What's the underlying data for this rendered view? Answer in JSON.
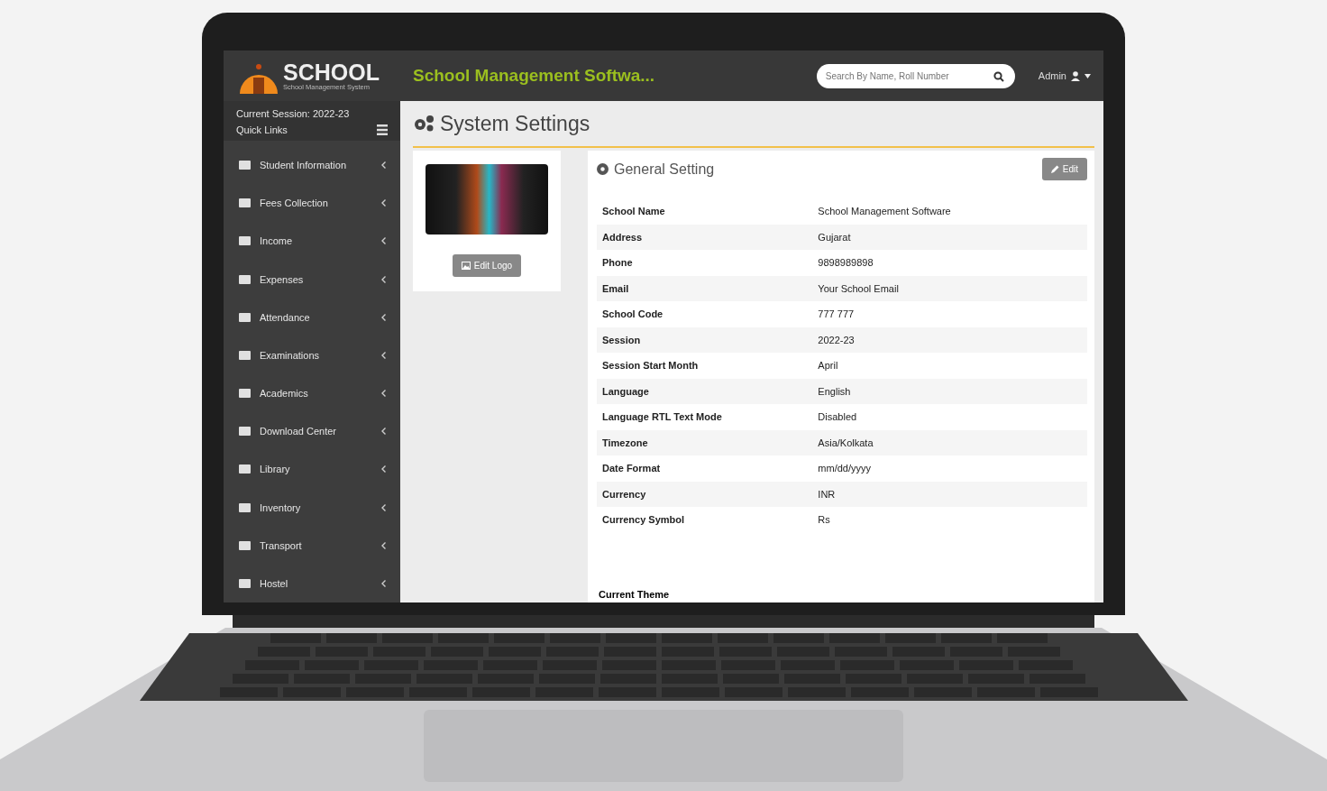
{
  "header": {
    "logo_text": "SCHOOL",
    "logo_subtitle": "School Management System",
    "title": "School Management Softwa...",
    "search": {
      "placeholder": "Search By Name, Roll Number"
    },
    "user": "Admin"
  },
  "sidebar": {
    "session": "Current Session: 2022-23",
    "quick_links": "Quick Links",
    "items": [
      {
        "label": "Student Information"
      },
      {
        "label": "Fees Collection"
      },
      {
        "label": "Income"
      },
      {
        "label": "Expenses"
      },
      {
        "label": "Attendance"
      },
      {
        "label": "Examinations"
      },
      {
        "label": "Academics"
      },
      {
        "label": "Download Center"
      },
      {
        "label": "Library"
      },
      {
        "label": "Inventory"
      },
      {
        "label": "Transport"
      },
      {
        "label": "Hostel"
      }
    ]
  },
  "page_title": "System Settings",
  "logo_card": {
    "edit_button": "Edit Logo"
  },
  "general_setting": {
    "title": "General Setting",
    "edit_button": "Edit",
    "rows": [
      {
        "label": "School Name",
        "value": "School Management Software"
      },
      {
        "label": "Address",
        "value": "Gujarat"
      },
      {
        "label": "Phone",
        "value": "9898989898"
      },
      {
        "label": "Email",
        "value": "Your School Email"
      },
      {
        "label": "School Code",
        "value": "777 777"
      },
      {
        "label": "Session",
        "value": "2022-23"
      },
      {
        "label": "Session Start Month",
        "value": "April"
      },
      {
        "label": "Language",
        "value": "English"
      },
      {
        "label": "Language RTL Text Mode",
        "value": "Disabled"
      },
      {
        "label": "Timezone",
        "value": "Asia/Kolkata"
      },
      {
        "label": "Date Format",
        "value": "mm/dd/yyyy"
      },
      {
        "label": "Currency",
        "value": "INR"
      },
      {
        "label": "Currency Symbol",
        "value": "Rs"
      }
    ],
    "current_theme": "Current Theme"
  }
}
